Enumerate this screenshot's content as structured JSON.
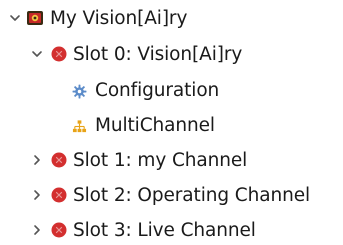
{
  "tree": {
    "root": {
      "label": "My Vision[Ai]ry",
      "expanded": true,
      "icon": "camera-app-icon"
    },
    "slots": [
      {
        "label": "Slot 0: Vision[Ai]ry",
        "expanded": true,
        "status_icon": "red-error-icon",
        "children": [
          {
            "label": "Configuration",
            "icon": "gear-icon"
          },
          {
            "label": "MultiChannel",
            "icon": "hierarchy-icon"
          }
        ]
      },
      {
        "label": "Slot 1: my Channel",
        "expanded": false,
        "status_icon": "red-error-icon"
      },
      {
        "label": "Slot 2: Operating Channel",
        "expanded": false,
        "status_icon": "red-error-icon"
      },
      {
        "label": "Slot 3: Live Channel",
        "expanded": false,
        "status_icon": "red-error-icon"
      }
    ]
  },
  "colors": {
    "error_red": "#d32f2f",
    "gear_blue": "#5b8bc9",
    "hierarchy_orange": "#e8a317",
    "text": "#1a1a1a",
    "chevron": "#555555"
  }
}
